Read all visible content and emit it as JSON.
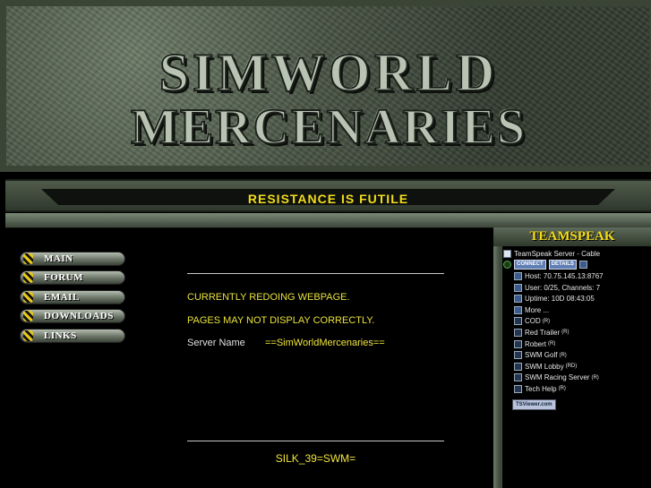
{
  "banner": {
    "title_line1": "SIMWORLD",
    "title_line2": "MERCENARIES",
    "slogan": "RESISTANCE  IS  FUTILE"
  },
  "nav": {
    "items": [
      {
        "label": "MAIN"
      },
      {
        "label": "FORUM"
      },
      {
        "label": "EMAIL"
      },
      {
        "label": "DOWNLOADS"
      },
      {
        "label": "LINKS"
      }
    ]
  },
  "content": {
    "line1": "CURRENTLY REDOING WEBPAGE.",
    "line2": "PAGES MAY NOT DISPLAY CORRECTLY.",
    "server_label": "Server Name",
    "server_value": "==SimWorldMercenaries==",
    "footer": "SILK_39=SWM="
  },
  "teamspeak": {
    "header": "TEAMSPEAK",
    "server_name": "TeamSpeak Server - Cable",
    "connect_label": "CONNECT",
    "details_label": "DETAILS",
    "info_rows": [
      "Host: 70.75.145.13:8767",
      "User: 0/25, Channels: 7",
      "Uptime: 10D 08:43:05",
      "More ..."
    ],
    "channels": [
      {
        "name": "COD",
        "flag": "(R)"
      },
      {
        "name": "Red Trailer",
        "flag": "(R)"
      },
      {
        "name": "Robert",
        "flag": "(R)"
      },
      {
        "name": "SWM Golf",
        "flag": "(R)"
      },
      {
        "name": "SWM Lobby",
        "flag": "(RD)"
      },
      {
        "name": "SWM Racing Server",
        "flag": "(R)"
      },
      {
        "name": "Tech Help",
        "flag": "(R)"
      }
    ],
    "viewer_badge": "TSViewer.com"
  }
}
